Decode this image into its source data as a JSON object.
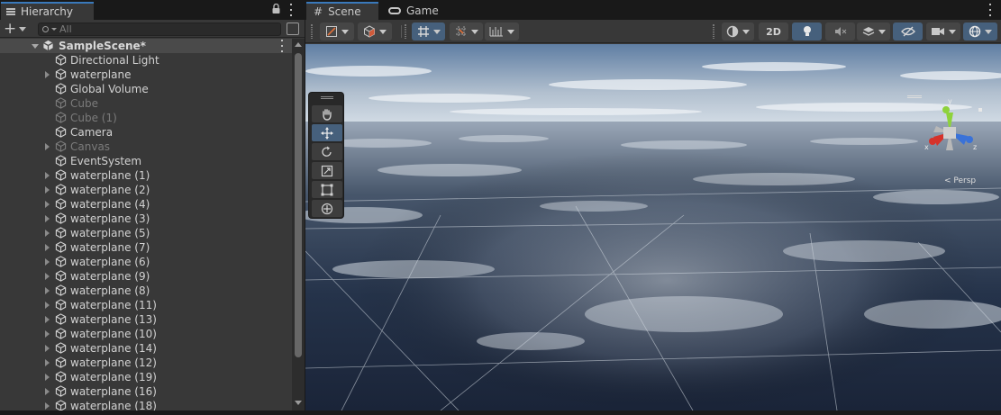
{
  "colors": {
    "accent": "#3a79bb",
    "panel_bg": "#383838",
    "selected_row_bg": "#4a4a4a",
    "active_button_bg": "#46607c"
  },
  "hierarchy": {
    "tab_label": "Hierarchy",
    "tab_icon": "hierarchy-lines-icon",
    "search_placeholder": "All",
    "scene": {
      "name": "SampleScene*",
      "expanded": true
    },
    "items": [
      {
        "label": "Directional Light",
        "active": true,
        "has_children": false
      },
      {
        "label": "waterplane",
        "active": true,
        "has_children": true
      },
      {
        "label": "Global Volume",
        "active": true,
        "has_children": false
      },
      {
        "label": "Cube",
        "active": false,
        "has_children": false
      },
      {
        "label": "Cube (1)",
        "active": false,
        "has_children": false
      },
      {
        "label": "Camera",
        "active": true,
        "has_children": false
      },
      {
        "label": "Canvas",
        "active": false,
        "has_children": true
      },
      {
        "label": "EventSystem",
        "active": true,
        "has_children": false
      },
      {
        "label": "waterplane (1)",
        "active": true,
        "has_children": true
      },
      {
        "label": "waterplane (2)",
        "active": true,
        "has_children": true
      },
      {
        "label": "waterplane (4)",
        "active": true,
        "has_children": true
      },
      {
        "label": "waterplane (3)",
        "active": true,
        "has_children": true
      },
      {
        "label": "waterplane (5)",
        "active": true,
        "has_children": true
      },
      {
        "label": "waterplane (7)",
        "active": true,
        "has_children": true
      },
      {
        "label": "waterplane (6)",
        "active": true,
        "has_children": true
      },
      {
        "label": "waterplane (9)",
        "active": true,
        "has_children": true
      },
      {
        "label": "waterplane (8)",
        "active": true,
        "has_children": true
      },
      {
        "label": "waterplane (11)",
        "active": true,
        "has_children": true
      },
      {
        "label": "waterplane (13)",
        "active": true,
        "has_children": true
      },
      {
        "label": "waterplane (10)",
        "active": true,
        "has_children": true
      },
      {
        "label": "waterplane (14)",
        "active": true,
        "has_children": true
      },
      {
        "label": "waterplane (12)",
        "active": true,
        "has_children": true
      },
      {
        "label": "waterplane (19)",
        "active": true,
        "has_children": true
      },
      {
        "label": "waterplane (16)",
        "active": true,
        "has_children": true
      },
      {
        "label": "waterplane (18)",
        "active": true,
        "has_children": true
      }
    ]
  },
  "scene_view": {
    "tabs": [
      {
        "label": "Scene",
        "icon": "hash-icon",
        "active": true
      },
      {
        "label": "Game",
        "icon": "gamepad-icon",
        "active": false
      }
    ],
    "toolbar": {
      "view_2d_label": "2D",
      "buttons": [
        "draw-mode-button",
        "shading-cube-button",
        "grid-snap-button",
        "increment-snap-button",
        "ruler-button",
        "shading-sphere-button",
        "2d-toggle-button",
        "lighting-toggle-button",
        "audio-toggle-button",
        "effects-button",
        "hidden-objects-button",
        "camera-settings-button",
        "gizmos-button"
      ]
    },
    "tools": [
      "hand-tool",
      "move-tool",
      "rotate-tool",
      "scale-tool",
      "rect-tool",
      "transform-tool"
    ],
    "active_tool": "move-tool",
    "gizmo": {
      "axes": [
        "y",
        "x",
        "z"
      ],
      "axis_colors": {
        "x": "#d6322a",
        "y": "#8ed23c",
        "z": "#3a72d8"
      },
      "projection_label": "< Persp"
    }
  }
}
